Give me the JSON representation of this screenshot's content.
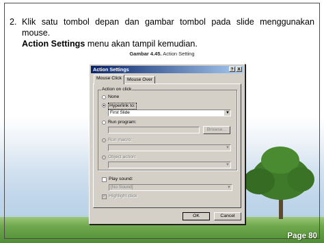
{
  "slide": {
    "item_number": "2.",
    "line1": "Klik satu tombol depan dan gambar tombol pada slide menggunakan mouse.",
    "bold_text": "Action Settings",
    "line2_rest": " menu akan tampil kemudian.",
    "caption_bold": "Gambar 4.45.",
    "caption_text": " Action Setting",
    "page_number": "Page 80"
  },
  "dialog": {
    "title": "Action Settings",
    "help_button": "?",
    "close_button": "X",
    "tabs": [
      {
        "label": "Mouse Click",
        "active": true
      },
      {
        "label": "Mouse Over",
        "active": false
      }
    ],
    "group_label": "Action on click",
    "options": {
      "none": "None",
      "hyperlink": "Hyperlink to:",
      "run_program": "Run program:",
      "run_macro": "Run macro:",
      "object_action": "Object action:"
    },
    "hyperlink_value": "First Slide",
    "browse_label": "Browse...",
    "play_sound_label": "Play sound:",
    "sound_value": "[No Sound]",
    "highlight_label": "Highlight click",
    "ok_label": "OK",
    "cancel_label": "Cancel"
  },
  "colors": {
    "title_bar_start": "#0a246a",
    "dialog_face": "#d4d0c8",
    "grass": "#5d9a3c"
  }
}
